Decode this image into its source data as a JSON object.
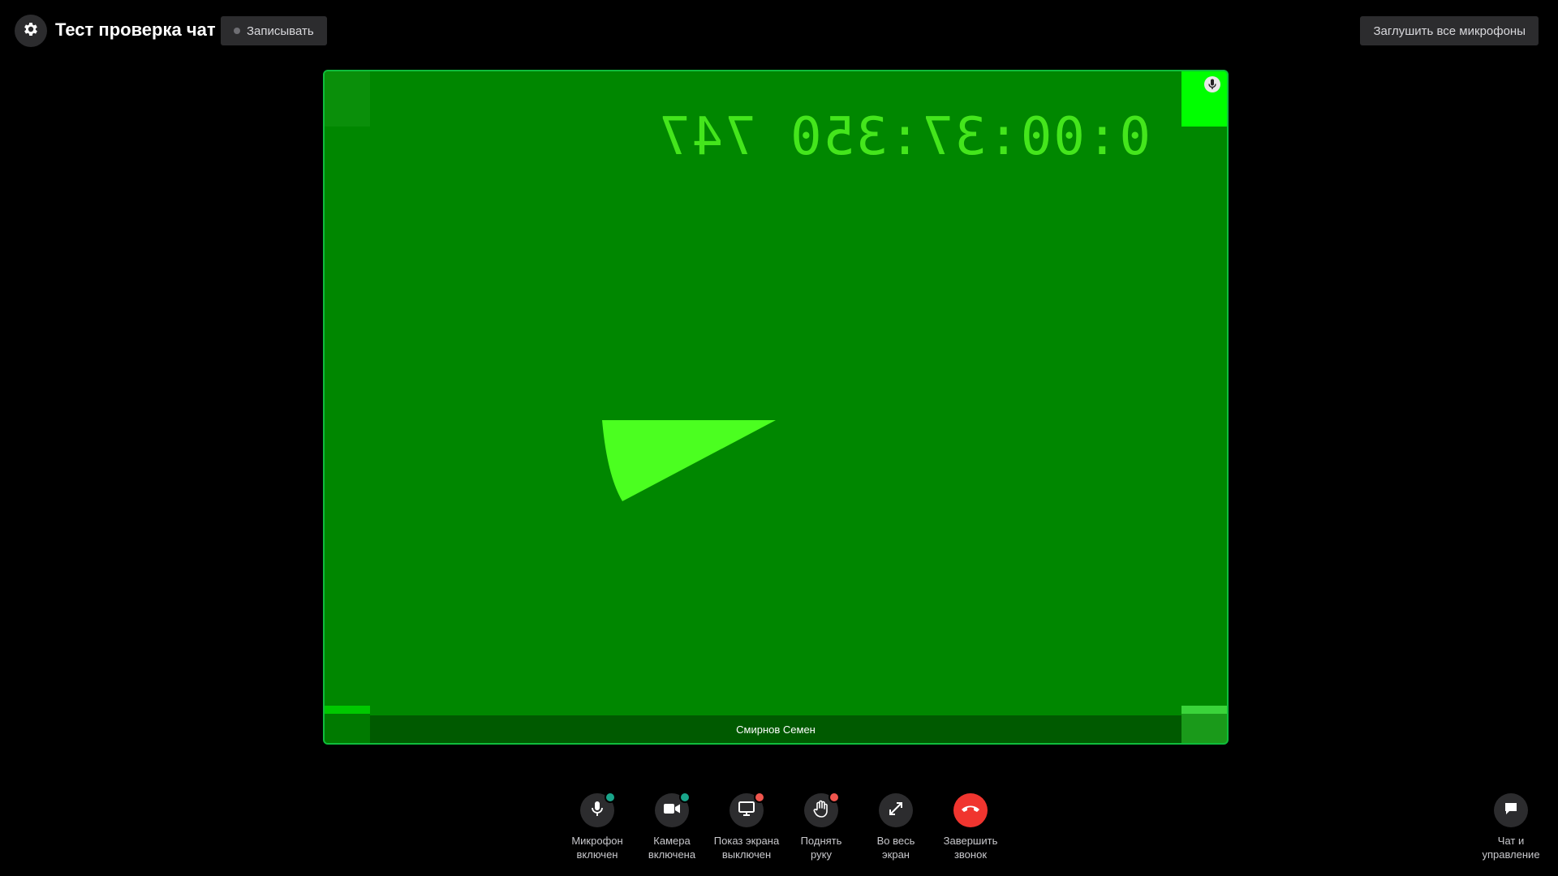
{
  "header": {
    "title": "Тест проверка чат",
    "record_label": "Записывать",
    "mute_all_label": "Заглушить все микрофоны"
  },
  "video": {
    "timecode": "0:00:37:350 747",
    "participant_name": "Смирнов Семен"
  },
  "controls": [
    {
      "label": "Микрофон\nвключен",
      "icon": "microphone-icon",
      "status_color": "#19a58a"
    },
    {
      "label": "Камера\nвключена",
      "icon": "video-camera-icon",
      "status_color": "#19a58a"
    },
    {
      "label": "Показ экрана\nвыключен",
      "icon": "monitor-icon",
      "status_color": "#f0554d"
    },
    {
      "label": "Поднять\nруку",
      "icon": "hand-icon",
      "status_color": "#f0554d"
    },
    {
      "label": "Во весь\nэкран",
      "icon": "expand-icon"
    },
    {
      "label": "Завершить\nзвонок",
      "icon": "phone-hangup-icon",
      "color": "#f0352f"
    }
  ],
  "chat": {
    "label": "Чат и\nуправление",
    "icon": "chat-bubble-icon"
  },
  "colors": {
    "video_background": "#008700",
    "video_border": "#0fbd3c",
    "accent_red": "#f0352f",
    "status_on": "#19a58a",
    "status_off": "#f0554d"
  }
}
